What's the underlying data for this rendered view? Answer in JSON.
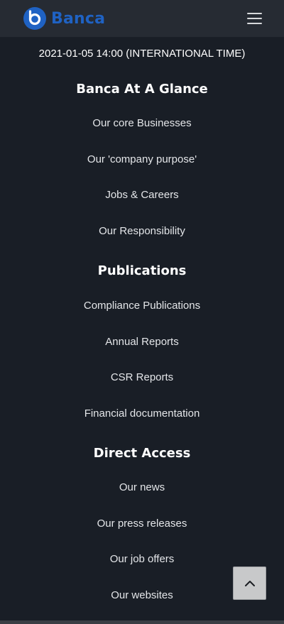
{
  "header": {
    "brand": "Banca",
    "logo_icon": "banca-logo-icon",
    "menu_icon": "hamburger-menu-icon",
    "brand_color": "#1f62c3"
  },
  "timestamp": "2021-01-05 14:00 (INTERNATIONAL TIME)",
  "sections": [
    {
      "heading": "Banca At A Glance",
      "links": [
        "Our core Businesses",
        "Our 'company purpose'",
        "Jobs & Careers",
        "Our Responsibility"
      ]
    },
    {
      "heading": "Publications",
      "links": [
        "Compliance Publications",
        "Annual Reports",
        "CSR Reports",
        "Financial documentation"
      ]
    },
    {
      "heading": "Direct Access",
      "links": [
        "Our news",
        "Our press releases",
        "Our job offers",
        "Our websites"
      ]
    }
  ],
  "back_to_top": {
    "icon": "chevron-up-icon"
  },
  "colors": {
    "background": "#191e26",
    "header_bg": "#262b33"
  }
}
